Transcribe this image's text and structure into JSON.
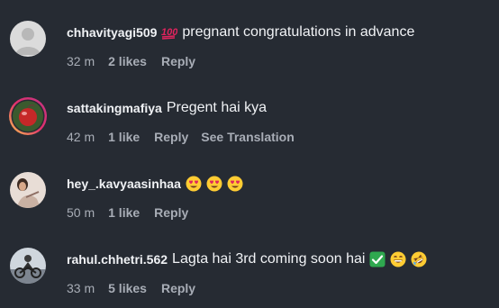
{
  "comments": [
    {
      "username": "chhavityagi509",
      "text": "pregnant congratulations in advance",
      "emojis_before": [
        "hundred-points-emoji"
      ],
      "emojis_after": [],
      "time": "32 m",
      "likes": "2 likes",
      "reply": "Reply",
      "translate": ""
    },
    {
      "username": "sattakingmafiya",
      "text": "Pregent hai kya",
      "emojis_before": [],
      "emojis_after": [],
      "time": "42 m",
      "likes": "1 like",
      "reply": "Reply",
      "translate": "See Translation"
    },
    {
      "username": "hey_.kavyaasinhaa",
      "text": "",
      "emojis_before": [],
      "emojis_after": [
        "heart-eyes-emoji",
        "heart-eyes-emoji",
        "heart-eyes-emoji"
      ],
      "time": "50 m",
      "likes": "1 like",
      "reply": "Reply",
      "translate": ""
    },
    {
      "username": "rahul.chhetri.562",
      "text": "Lagta hai 3rd coming soon hai",
      "emojis_before": [],
      "emojis_after": [
        "check-mark-emoji",
        "grinning-emoji",
        "rofl-emoji"
      ],
      "time": "33 m",
      "likes": "5 likes",
      "reply": "Reply",
      "translate": ""
    }
  ],
  "colors": {
    "background": "#262b33",
    "primary_text": "#f0f2f5",
    "secondary_text": "#a8adb6",
    "hundred_red": "#e0245e",
    "emoji_yellow": "#ffcc33",
    "check_green": "#2fa84f"
  }
}
